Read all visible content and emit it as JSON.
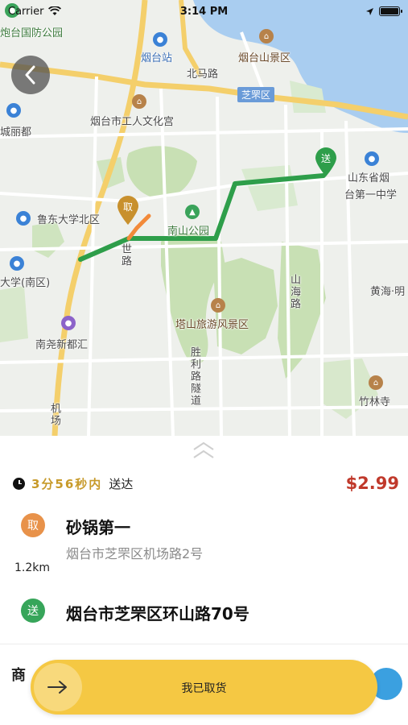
{
  "status_bar": {
    "carrier": "Carrier",
    "time": "3:14 PM"
  },
  "map": {
    "labels": {
      "paotai": "炮台国防公园",
      "yantai_station": "烟台站",
      "yantaishan": "烟台山景区",
      "beima_road": "北马路",
      "zhifu_district": "芝罘区",
      "workers_palace": "烟台市工人文化宫",
      "chengli": "城丽都",
      "ludong_north": "鲁东大学北区",
      "nanshan_park": "南山公园",
      "shandong_school": "山东省烟台第一中学",
      "shandong_school_line1": "山东省烟",
      "shandong_school_line2": "台第一中学",
      "university_south": "大学(南区)",
      "huanghai": "黄海·明",
      "shanhai_road": "山海路",
      "tashan": "塔山旅游风景区",
      "nanyao": "南尧新都汇",
      "shengli_tunnel": "胜利路隧道",
      "zhulin_temple": "竹林寺",
      "jichang_road": "机场",
      "shi_road": "世路"
    },
    "pickup_marker": "取",
    "dropoff_marker": "送",
    "route_color": "#2e9e4a"
  },
  "order": {
    "eta_time": "3分56秒内",
    "eta_suffix": "送达",
    "price": "$2.99",
    "pickup_badge": "取",
    "pickup_name": "砂锅第一",
    "pickup_address": "烟台市芝罘区机场路2号",
    "distance": "1.2km",
    "dropoff_badge": "送",
    "dropoff_address": "烟台市芝罘区环山路70号",
    "partial_text": "商"
  },
  "action": {
    "slide_label": "我已取货"
  },
  "colors": {
    "accent_yellow": "#f5c843",
    "price_red": "#c0392b",
    "eta_gold": "#c79a2a",
    "pickup_orange": "#e8924a",
    "dropoff_green": "#37a55a"
  }
}
